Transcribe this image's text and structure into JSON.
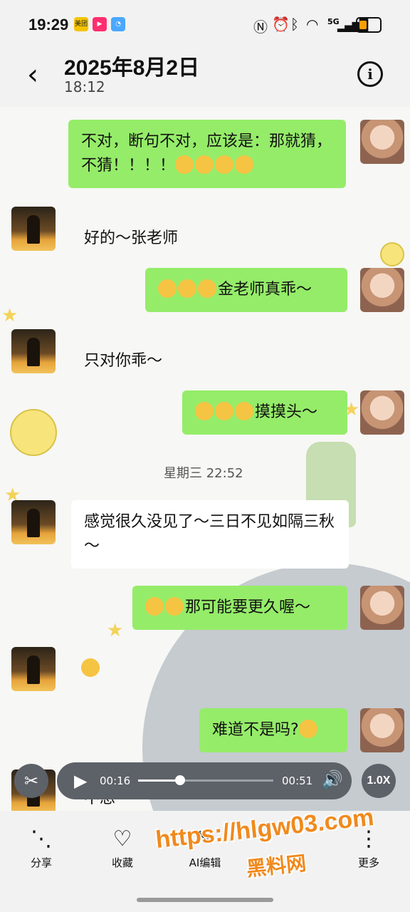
{
  "status_bar": {
    "time": "19:29",
    "app_icons": [
      "美团",
      "▶",
      "◔"
    ],
    "network": "5G",
    "icons": [
      "nfc-icon",
      "alarm-icon",
      "bluetooth-icon",
      "wifi-icon",
      "signal-icon",
      "battery-icon"
    ]
  },
  "header": {
    "back_icon": "‹",
    "title": "2025年8月2日",
    "subtitle": "18:12",
    "info_icon": "i"
  },
  "messages": [
    {
      "side": "right",
      "text": "不对，断句不对，应该是：那就猜，不猜！！！！",
      "emojis": 4
    },
    {
      "side": "left",
      "text": "好的～张老师",
      "emojis": 0
    },
    {
      "side": "right",
      "text": "金老师真乖～",
      "emojis": 3
    },
    {
      "side": "left",
      "text": "只对你乖～",
      "emojis": 0
    },
    {
      "side": "right",
      "text": "摸摸头～",
      "emojis": 3
    },
    {
      "side": "left",
      "text": "感觉很久没见了～三日不见如隔三秋～",
      "emojis": 0
    },
    {
      "side": "right",
      "text": "那可能要更久喔～",
      "emojis": 2
    },
    {
      "side": "left",
      "text": "",
      "emojis": 1
    },
    {
      "side": "right",
      "text": "难道不是吗?",
      "emojis": 1
    },
    {
      "side": "left",
      "text": "不想～",
      "emojis": 0
    }
  ],
  "timestamp": "星期三 22:52",
  "player": {
    "current_time": "00:16",
    "duration": "00:51",
    "progress": 0.31,
    "speed": "1.0X",
    "play_icon": "▶",
    "volume_icon": "🔊",
    "cut_icon": "✂"
  },
  "toolbar": {
    "share_label": "分享",
    "favorite_label": "收藏",
    "edit_label": "AI编辑",
    "more_label": "更多"
  },
  "watermark": {
    "url": "https://hlgw03.com",
    "name": "黑料网"
  },
  "colors": {
    "green_bubble": "#95ec69",
    "white_bubble": "#ffffff",
    "header_bg": "#f2f2f2"
  }
}
